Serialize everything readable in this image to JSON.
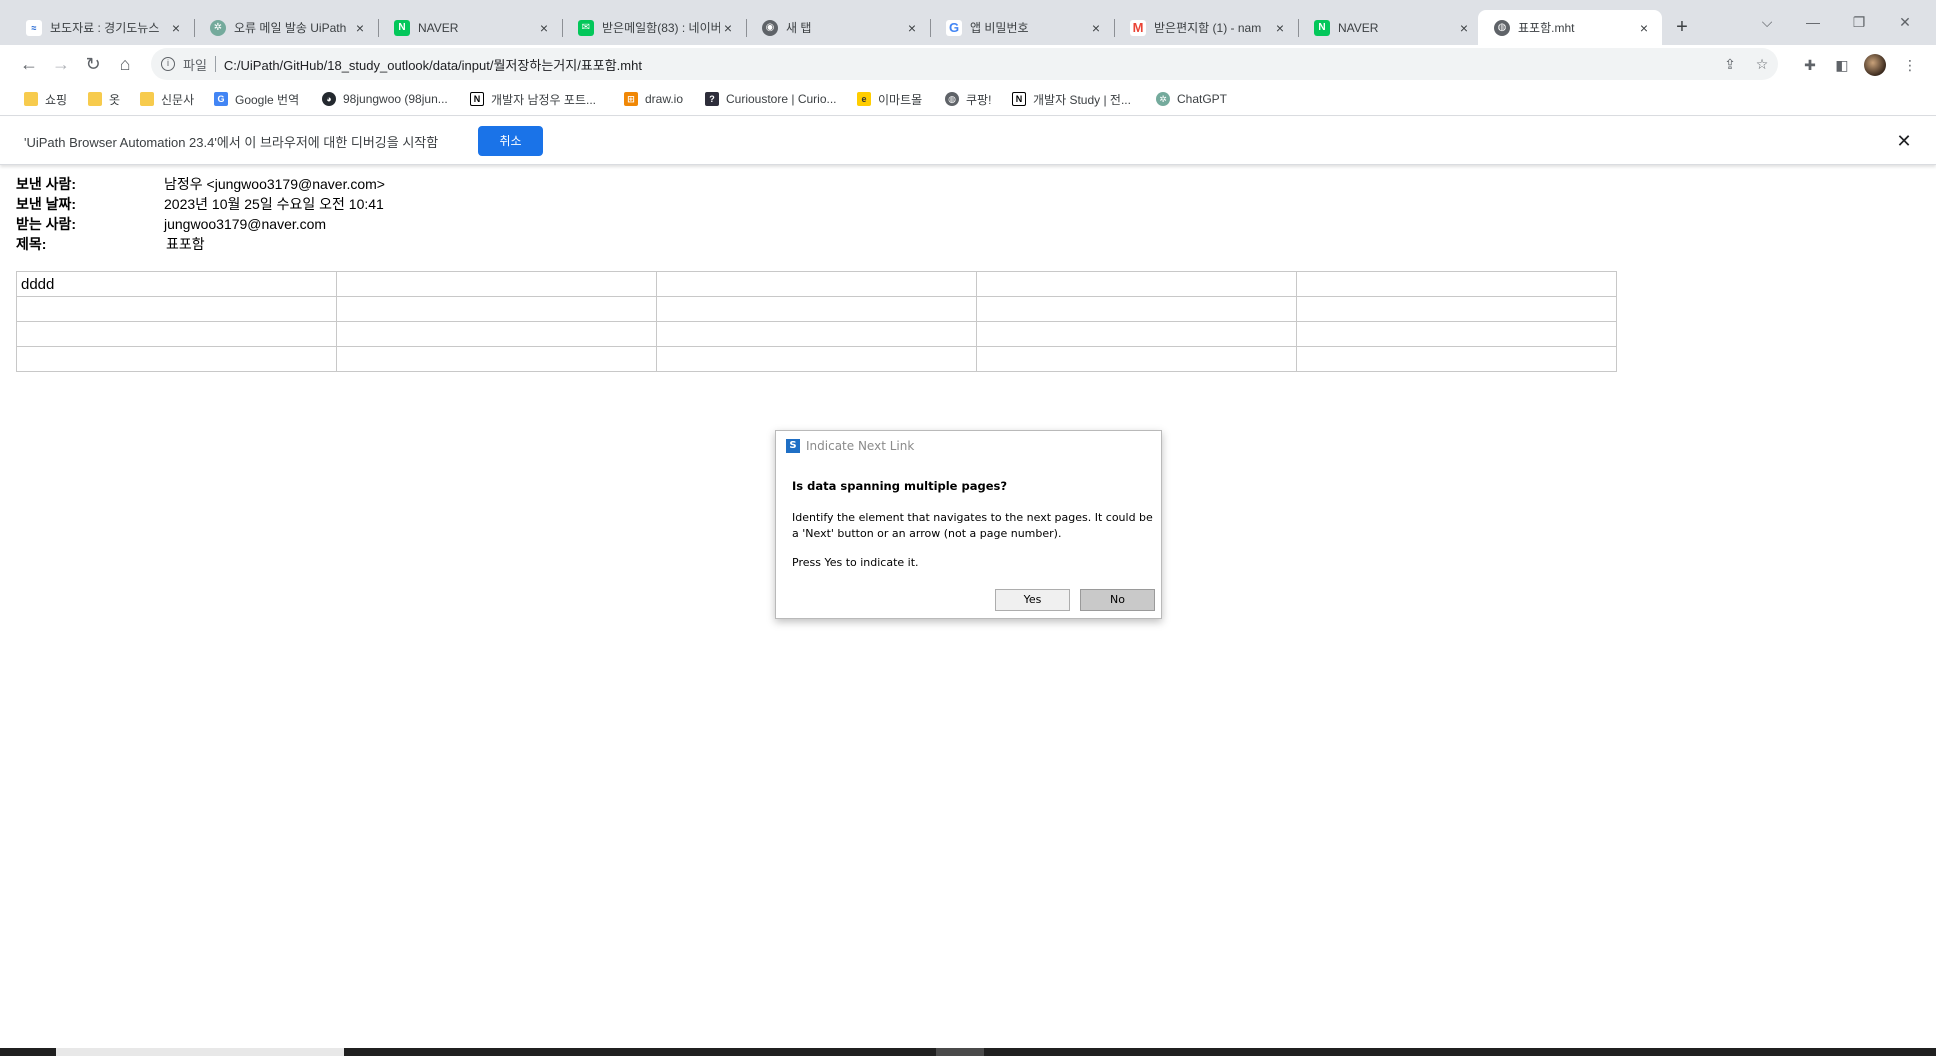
{
  "browser": {
    "tabs": [
      {
        "title": "보도자료 : 경기도뉴스",
        "icon": "news-favicon",
        "color": "#0b57d0"
      },
      {
        "title": "오류 메일 발송 UiPath",
        "icon": "chatgpt-favicon",
        "color": "#74aa9c"
      },
      {
        "title": "NAVER",
        "icon": "naver-favicon",
        "color": "#03c75a"
      },
      {
        "title": "받은메일함(83) : 네이버",
        "icon": "naver-mail-favicon",
        "color": "#03c75a"
      },
      {
        "title": "새 탭",
        "icon": "chrome-favicon",
        "color": "#5f6368"
      },
      {
        "title": "앱 비밀번호",
        "icon": "google-favicon",
        "color": "#4285f4"
      },
      {
        "title": "받은편지함 (1) - nam",
        "icon": "gmail-favicon",
        "color": "#ea4335"
      },
      {
        "title": "NAVER",
        "icon": "naver-favicon",
        "color": "#03c75a"
      },
      {
        "title": "표포함.mht",
        "icon": "globe-favicon",
        "color": "#5f6368",
        "active": true
      }
    ],
    "close_glyph": "×",
    "new_tab_glyph": "+",
    "window_controls": {
      "dropdown": "⌵",
      "minimize": "—",
      "restore": "❐",
      "close": "✕"
    },
    "address": {
      "scheme_label": "파일",
      "url": "C:/UiPath/GitHub/18_study_outlook/data/input/뭘저장하는거지/표포함.mht"
    },
    "bookmarks": [
      {
        "label": "쇼핑",
        "icon": "folder-icon"
      },
      {
        "label": "옷",
        "icon": "folder-icon"
      },
      {
        "label": "신문사",
        "icon": "folder-icon"
      },
      {
        "label": "Google 번역",
        "icon": "translate-icon"
      },
      {
        "label": "98jungwoo (98jun...",
        "icon": "github-icon"
      },
      {
        "label": "개발자 남정우 포트...",
        "icon": "notion-icon"
      },
      {
        "label": "draw.io",
        "icon": "drawio-icon"
      },
      {
        "label": "Curioustore | Curio...",
        "icon": "curio-icon"
      },
      {
        "label": "이마트몰",
        "icon": "emart-icon"
      },
      {
        "label": "쿠팡!",
        "icon": "coupang-icon"
      },
      {
        "label": "개발자 Study | 전...",
        "icon": "notion-icon"
      },
      {
        "label": "ChatGPT",
        "icon": "chatgpt-icon"
      }
    ]
  },
  "infobar": {
    "message": "'UiPath Browser Automation 23.4'에서 이 브라우저에 대한 디버깅을 시작함",
    "cancel_label": "취소",
    "close_glyph": "✕"
  },
  "email": {
    "from_label": "보낸 사람:",
    "from_value": "남정우 <jungwoo3179@naver.com>",
    "date_label": "보낸 날짜:",
    "date_value": "2023년 10월 25일 수요일 오전 10:41",
    "to_label": "받는 사람:",
    "to_value": "jungwoo3179@naver.com",
    "subject_label": "제목:",
    "subject_value": "표포함",
    "table": [
      [
        "dddd",
        "",
        "",
        "",
        ""
      ],
      [
        "",
        "",
        "",
        "",
        ""
      ],
      [
        "",
        "",
        "",
        "",
        ""
      ],
      [
        "",
        "",
        "",
        "",
        ""
      ]
    ]
  },
  "dialog": {
    "title": "Indicate Next Link",
    "icon_glyph": "S",
    "heading": "Is data spanning multiple pages?",
    "body": "Identify the element that navigates to the next pages. It could be a 'Next' button or an arrow (not a page number).",
    "press": "Press Yes to indicate it.",
    "yes_label": "Yes",
    "no_label": "No"
  }
}
